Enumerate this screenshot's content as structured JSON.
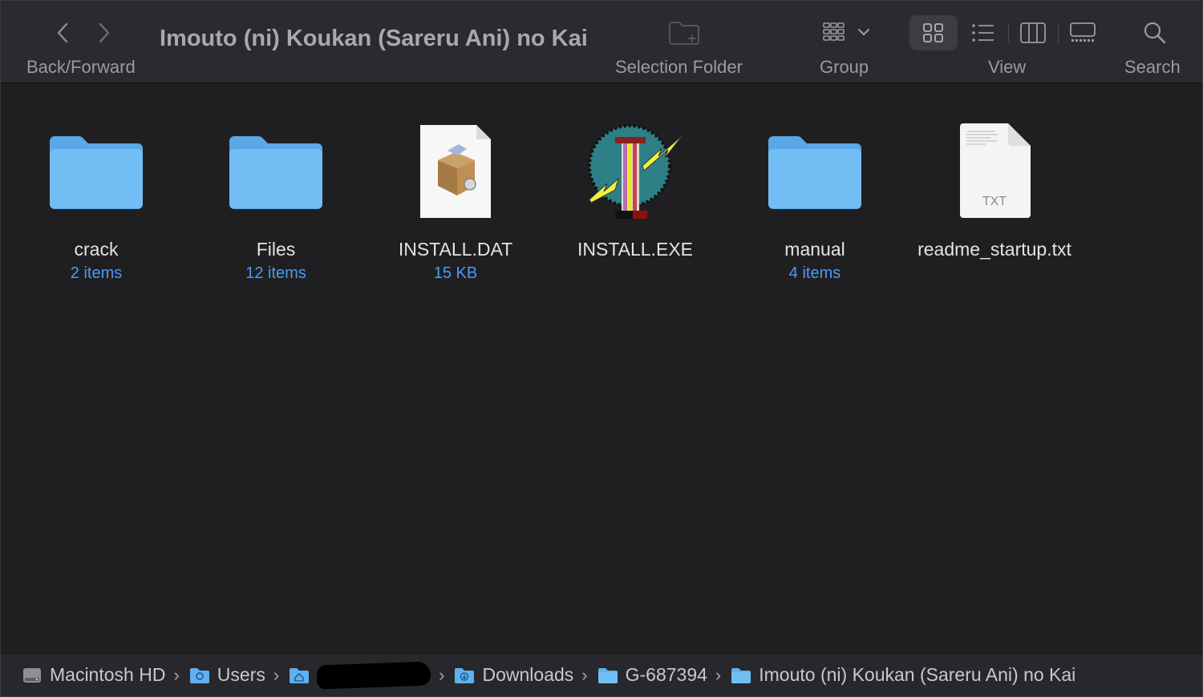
{
  "toolbar": {
    "back_forward_label": "Back/Forward",
    "title": "Imouto (ni) Koukan (Sareru Ani) no Kai",
    "selection_folder_label": "Selection Folder",
    "group_label": "Group",
    "view_label": "View",
    "search_label": "Search"
  },
  "items": [
    {
      "name": "crack",
      "sub": "2 items",
      "icon": "folder-icon"
    },
    {
      "name": "Files",
      "sub": "12 items",
      "icon": "folder-icon"
    },
    {
      "name": "INSTALL.DAT",
      "sub": "15 KB",
      "icon": "installer-package-icon"
    },
    {
      "name": "INSTALL.EXE",
      "sub": "",
      "icon": "exe-app-icon"
    },
    {
      "name": "manual",
      "sub": "4 items",
      "icon": "folder-icon"
    },
    {
      "name": "readme_startup.txt",
      "sub": "",
      "icon": "txt-document-icon",
      "badge": "TXT"
    }
  ],
  "pathbar": {
    "crumbs": [
      "Macintosh HD",
      "Users",
      "",
      "Downloads",
      "G-687394",
      "Imouto (ni) Koukan (Sareru Ani) no Kai"
    ]
  },
  "colors": {
    "accent": "#4a9bf4",
    "folder": "#6cb8f0",
    "background": "#1f1f22"
  }
}
